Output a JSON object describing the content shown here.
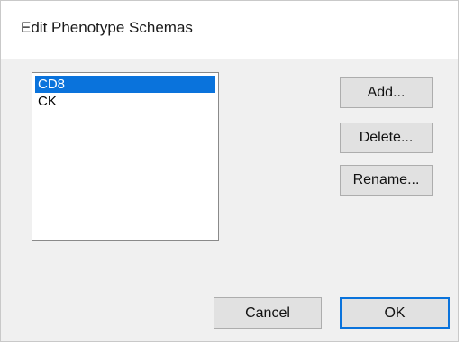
{
  "dialog": {
    "title": "Edit Phenotype Schemas"
  },
  "schemas": {
    "items": [
      {
        "label": "CD8",
        "selected": true
      },
      {
        "label": "CK",
        "selected": false
      }
    ]
  },
  "actions": {
    "add_label": "Add...",
    "delete_label": "Delete...",
    "rename_label": "Rename..."
  },
  "footer": {
    "cancel_label": "Cancel",
    "ok_label": "OK"
  },
  "colors": {
    "selection": "#0a73dc",
    "default_button_border": "#0a73dc",
    "dialog_background": "#f0f0f0"
  }
}
